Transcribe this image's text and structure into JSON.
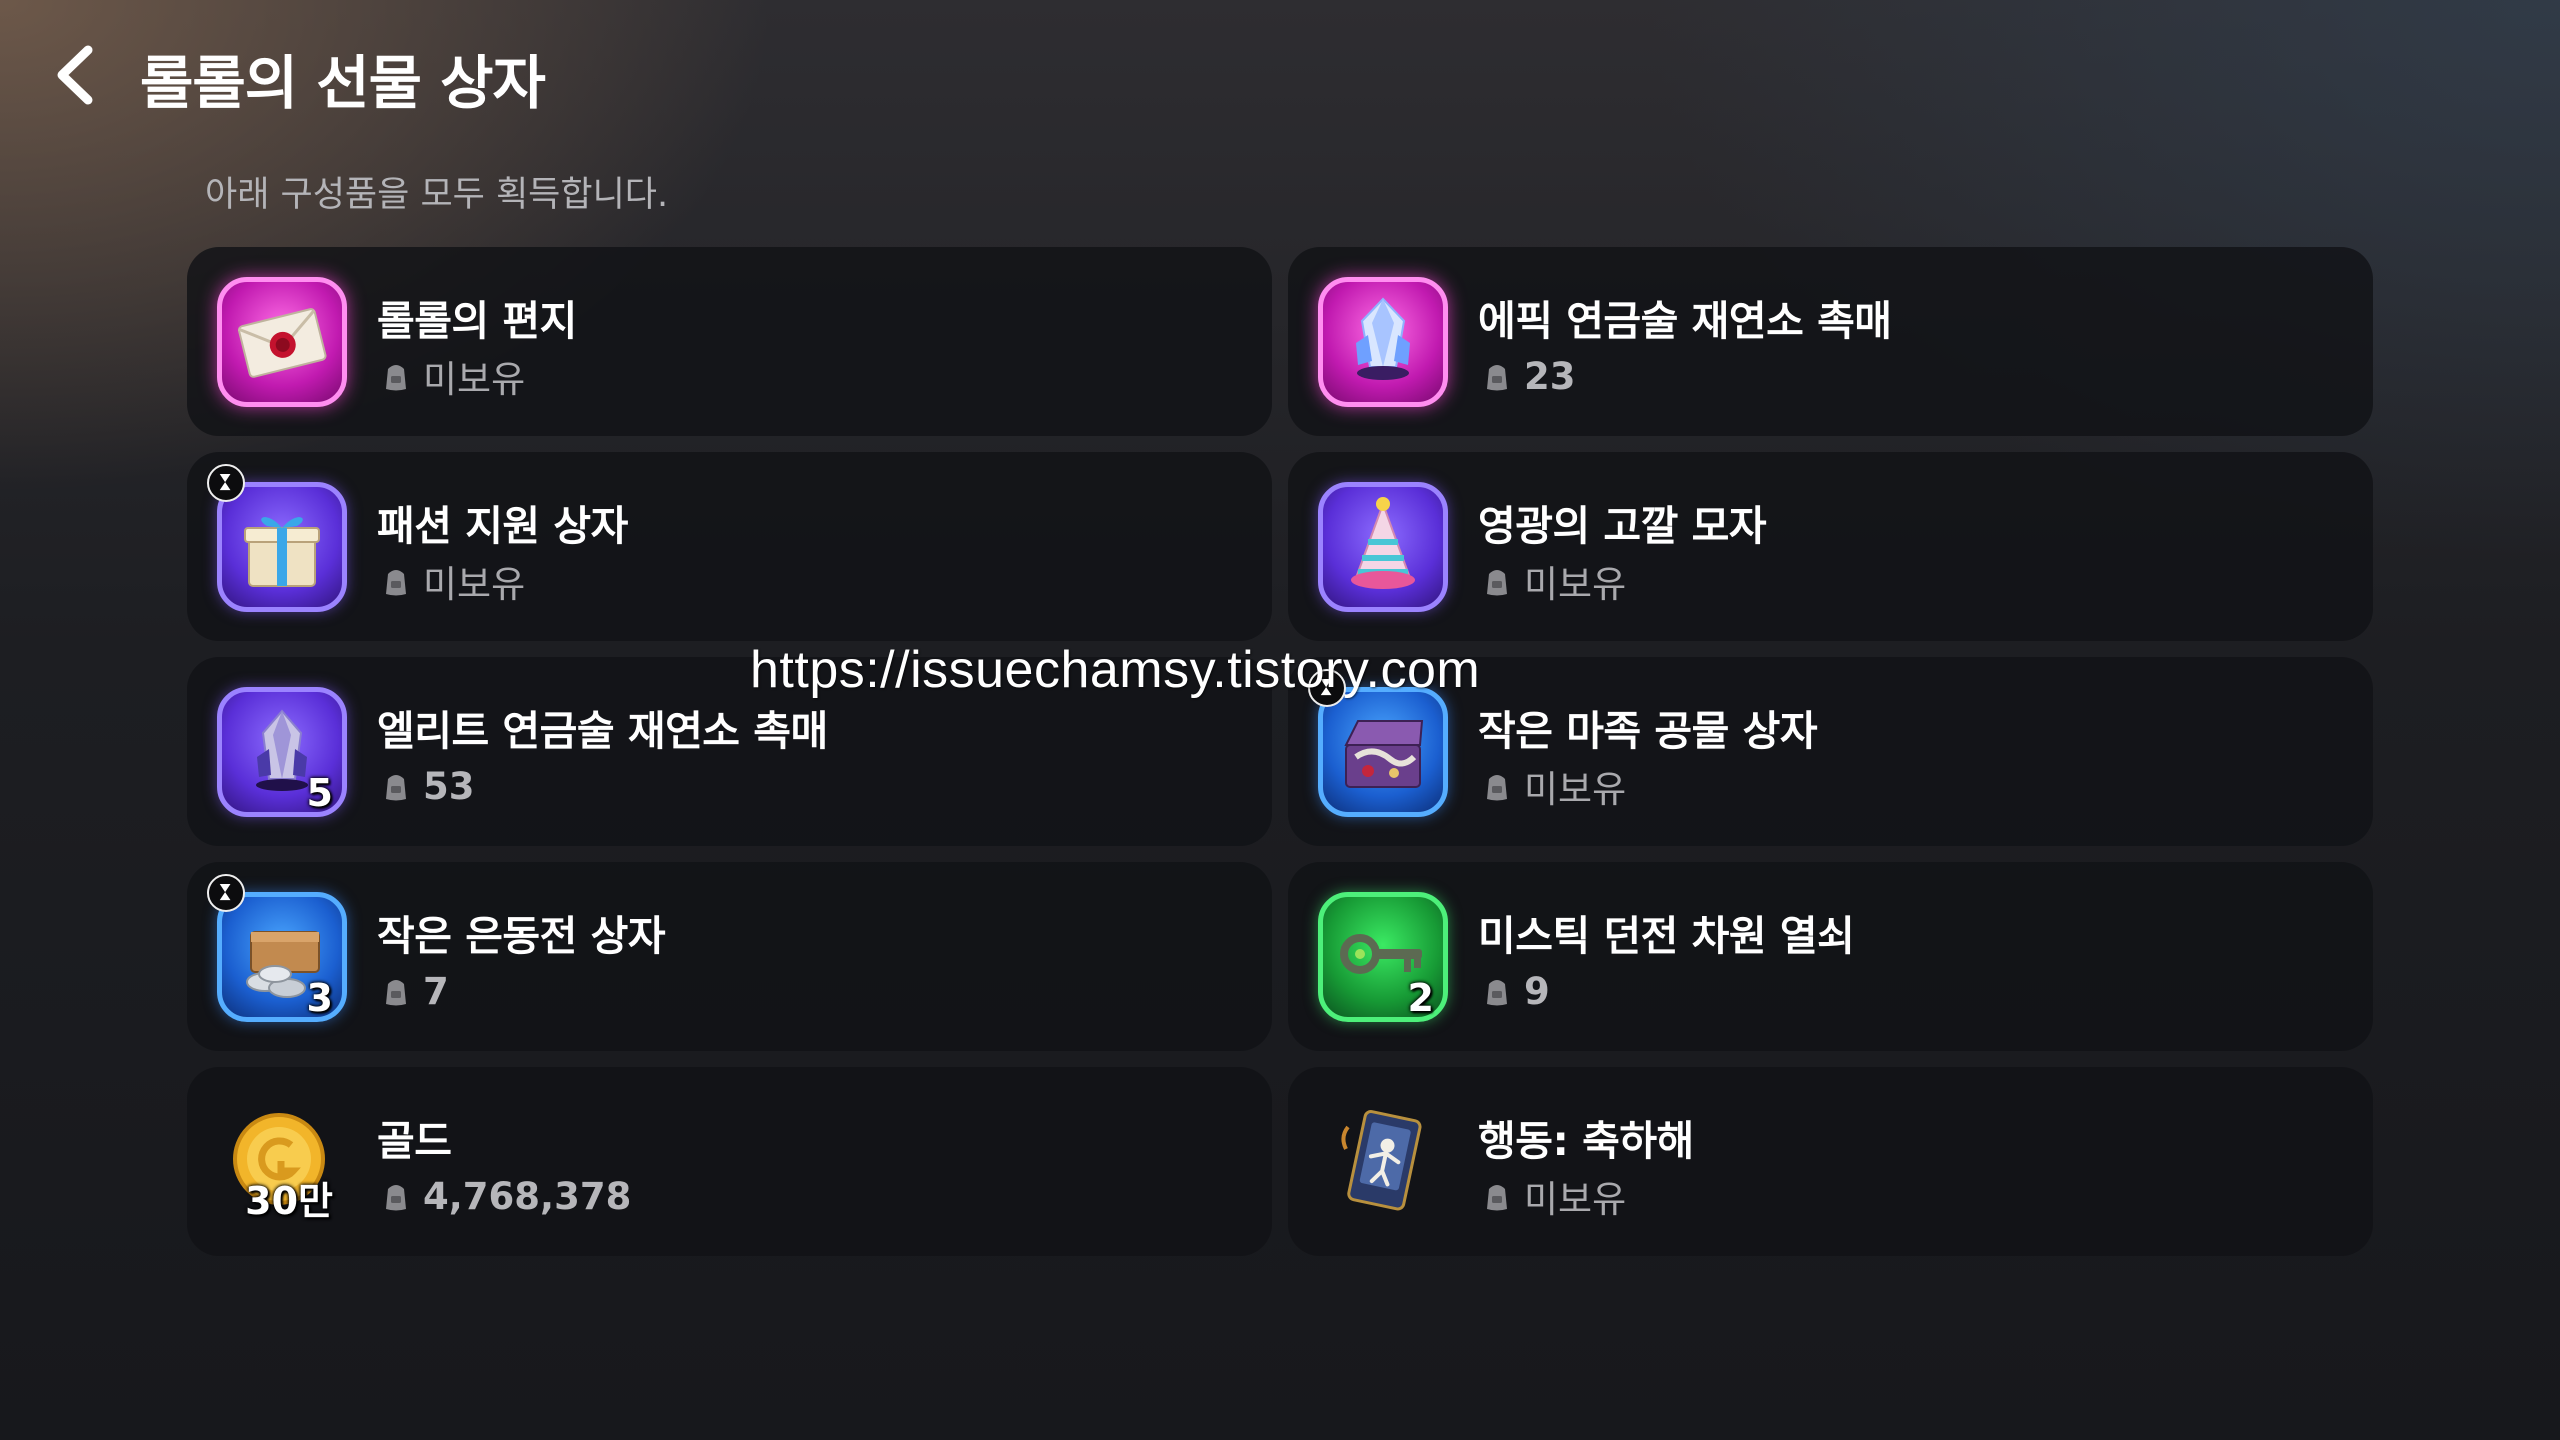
{
  "header": {
    "title": "롤롤의 선물 상자",
    "subtitle": "아래 구성품을 모두 획득합니다."
  },
  "items": [
    {
      "name": "롤롤의 편지",
      "owned": "미보유",
      "qty": "",
      "rarity": "epic",
      "icon": "letter-icon",
      "timer": false
    },
    {
      "name": "에픽 연금술 재연소 촉매",
      "owned": "23",
      "qty": "",
      "rarity": "epic",
      "icon": "crystal-icon",
      "timer": false
    },
    {
      "name": "패션 지원 상자",
      "owned": "미보유",
      "qty": "",
      "rarity": "purple",
      "icon": "gift-box-icon",
      "timer": true
    },
    {
      "name": "영광의 고깔 모자",
      "owned": "미보유",
      "qty": "",
      "rarity": "purple",
      "icon": "party-hat-icon",
      "timer": false
    },
    {
      "name": "엘리트 연금술 재연소 촉매",
      "owned": "53",
      "qty": "5",
      "rarity": "purple",
      "icon": "dark-crystal-icon",
      "timer": false
    },
    {
      "name": "작은 마족 공물 상자",
      "owned": "미보유",
      "qty": "",
      "rarity": "blue",
      "icon": "treasure-chest-icon",
      "timer": true
    },
    {
      "name": "작은 은동전 상자",
      "owned": "7",
      "qty": "3",
      "rarity": "blue",
      "icon": "coin-chest-icon",
      "timer": true
    },
    {
      "name": "미스틱 던전 차원 열쇠",
      "owned": "9",
      "qty": "2",
      "rarity": "green",
      "icon": "key-icon",
      "timer": false
    },
    {
      "name": "골드",
      "owned": "4,768,378",
      "qty": "30만",
      "rarity": "none",
      "icon": "gold-coin-icon",
      "timer": false
    },
    {
      "name": "행동: 축하해",
      "owned": "미보유",
      "qty": "",
      "rarity": "none",
      "icon": "action-card-icon",
      "timer": false
    }
  ],
  "watermark": "https://issuechamsy.tistory.com",
  "colors": {
    "epic": "#e62fd0",
    "purple": "#6a44f0",
    "blue": "#2f7cf0",
    "green": "#22c44a",
    "card_bg": "#121318"
  }
}
